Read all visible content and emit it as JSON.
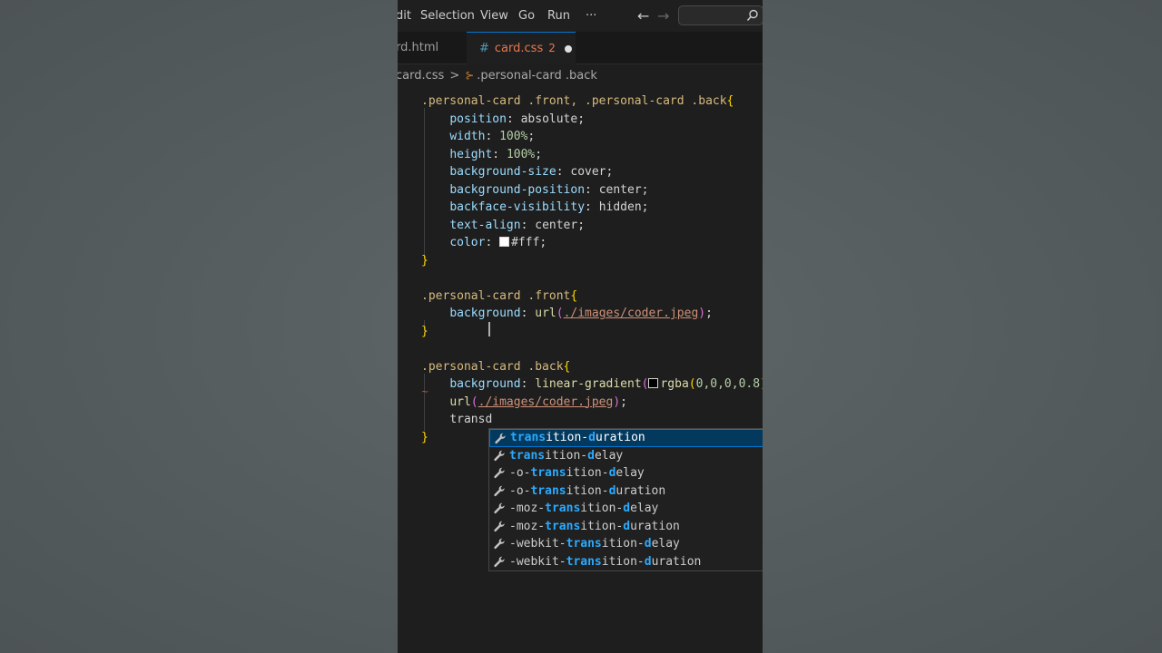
{
  "menubar": {
    "items": [
      "dit",
      "Selection",
      "View",
      "Go",
      "Run",
      "···"
    ],
    "back_arrow": "←",
    "forward_arrow": "→"
  },
  "tabs": [
    {
      "label": "rd.html",
      "active": false
    },
    {
      "label": "card.css",
      "hash": "#",
      "problems": "2",
      "modified": true,
      "active": true
    }
  ],
  "breadcrumb": {
    "file": "card.css",
    "separator": ">",
    "symbol": ".personal-card .back"
  },
  "editor": {
    "block1": {
      "selector": ".personal-card .front, .personal-card .back",
      "open": "{",
      "decls": [
        {
          "prop": "position",
          "val": "absolute"
        },
        {
          "prop": "width",
          "val": "100%"
        },
        {
          "prop": "height",
          "val": "100%"
        },
        {
          "prop": "background-size",
          "val": "cover"
        },
        {
          "prop": "background-position",
          "val": "center"
        },
        {
          "prop": "backface-visibility",
          "val": "hidden"
        },
        {
          "prop": "text-align",
          "val": "center"
        },
        {
          "prop": "color",
          "val": "#fff"
        }
      ],
      "close": "}"
    },
    "block2": {
      "selector": ".personal-card .front",
      "open": "{",
      "prop": "background",
      "fn": "url",
      "arg": "./images/coder.jpeg",
      "close": "}"
    },
    "block3": {
      "selector": ".personal-card .back",
      "open": "{",
      "prop": "background",
      "fn": "linear-gradient",
      "rgba_fn": "rgba",
      "rgba_args": "0,0,0,0.8",
      "url_fn": "url",
      "url_arg": "./images/coder.jpeg",
      "typed": "transd",
      "close": "}"
    }
  },
  "suggestions": [
    {
      "match": "trans",
      "mid": "ition-",
      "match2": "d",
      "rest": "uration",
      "pre": "",
      "selected": true
    },
    {
      "match": "trans",
      "mid": "ition-",
      "match2": "d",
      "rest": "elay",
      "pre": "",
      "selected": false
    },
    {
      "pre": "-o-",
      "match": "trans",
      "mid": "ition-",
      "match2": "d",
      "rest": "elay",
      "selected": false
    },
    {
      "pre": "-o-",
      "match": "trans",
      "mid": "ition-",
      "match2": "d",
      "rest": "uration",
      "selected": false
    },
    {
      "pre": "-moz-",
      "match": "trans",
      "mid": "ition-",
      "match2": "d",
      "rest": "elay",
      "selected": false
    },
    {
      "pre": "-moz-",
      "match": "trans",
      "mid": "ition-",
      "match2": "d",
      "rest": "uration",
      "selected": false
    },
    {
      "pre": "-webkit-",
      "match": "trans",
      "mid": "ition-",
      "match2": "d",
      "rest": "elay",
      "selected": false
    },
    {
      "pre": "-webkit-",
      "match": "trans",
      "mid": "ition-",
      "match2": "d",
      "rest": "uration",
      "selected": false
    }
  ],
  "icons": {
    "suggestion": "wrench-icon",
    "search": "search-icon",
    "breadcrumb_symbol": "css-selector-icon"
  },
  "colors": {
    "tab_error": "#e7784f",
    "accent": "#0078d4",
    "match_highlight": "#2aaaff"
  }
}
